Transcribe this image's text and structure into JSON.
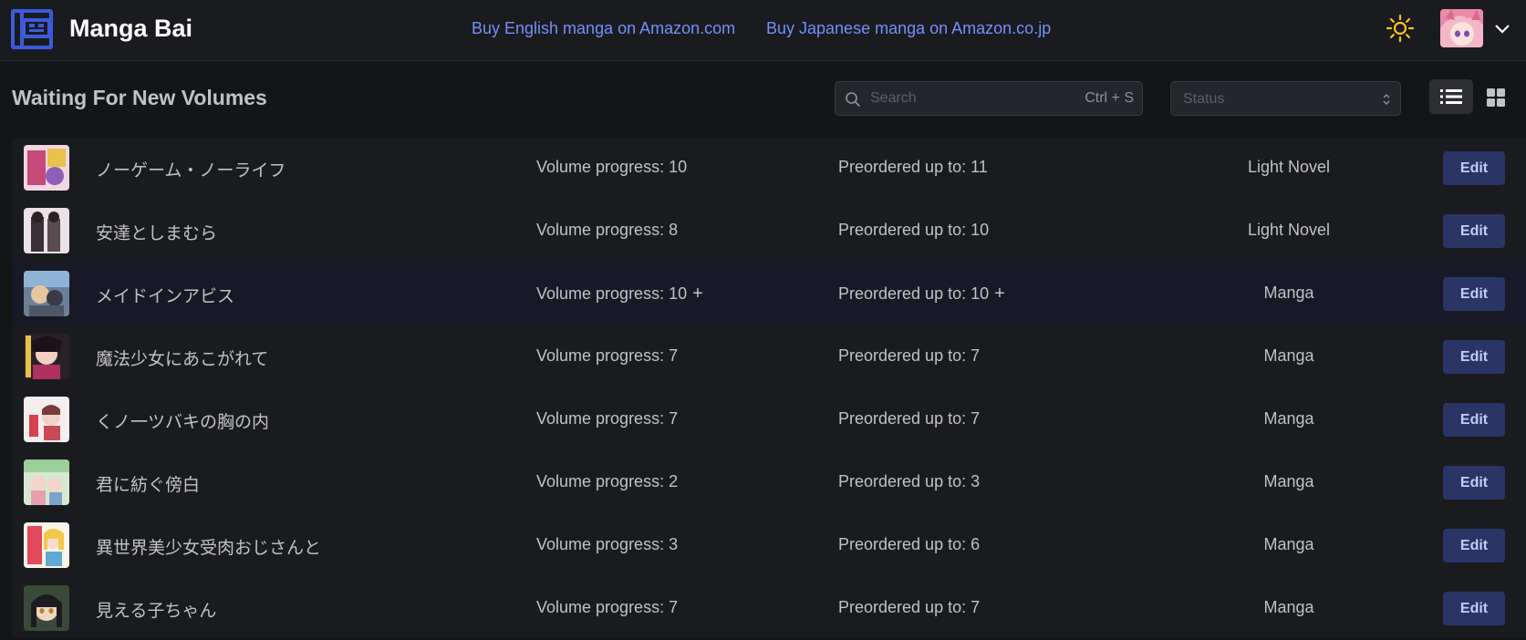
{
  "header": {
    "brand": "Manga Bai",
    "links": [
      "Buy English manga on Amazon.com",
      "Buy Japanese manga on Amazon.co.jp"
    ]
  },
  "toolbar": {
    "title": "Waiting For New Volumes",
    "search_placeholder": "Search",
    "search_hint": "Ctrl + S",
    "status_placeholder": "Status"
  },
  "colors": {
    "accent": "#748ffc",
    "edit_button": "#2a3566",
    "sun": "#fcc419"
  },
  "rows": [
    {
      "title": "ノーゲーム・ノーライフ",
      "volume": "Volume progress: 10",
      "preorder": "Preordered up to: 11",
      "type": "Light Novel",
      "edit": "Edit",
      "plus": ""
    },
    {
      "title": "安達としまむら",
      "volume": "Volume progress: 8",
      "preorder": "Preordered up to: 10",
      "type": "Light Novel",
      "edit": "Edit",
      "plus": ""
    },
    {
      "title": "メイドインアビス",
      "volume": "Volume progress: 10",
      "preorder": "Preordered up to: 10",
      "type": "Manga",
      "edit": "Edit",
      "plus": "+"
    },
    {
      "title": "魔法少女にあこがれて",
      "volume": "Volume progress: 7",
      "preorder": "Preordered up to: 7",
      "type": "Manga",
      "edit": "Edit",
      "plus": ""
    },
    {
      "title": "くノ一ツバキの胸の内",
      "volume": "Volume progress: 7",
      "preorder": "Preordered up to: 7",
      "type": "Manga",
      "edit": "Edit",
      "plus": ""
    },
    {
      "title": "君に紡ぐ傍白",
      "volume": "Volume progress: 2",
      "preorder": "Preordered up to: 3",
      "type": "Manga",
      "edit": "Edit",
      "plus": ""
    },
    {
      "title": "異世界美少女受肉おじさんと",
      "volume": "Volume progress: 3",
      "preorder": "Preordered up to: 6",
      "type": "Manga",
      "edit": "Edit",
      "plus": ""
    },
    {
      "title": "見える子ちゃん",
      "volume": "Volume progress: 7",
      "preorder": "Preordered up to: 7",
      "type": "Manga",
      "edit": "Edit",
      "plus": ""
    }
  ]
}
